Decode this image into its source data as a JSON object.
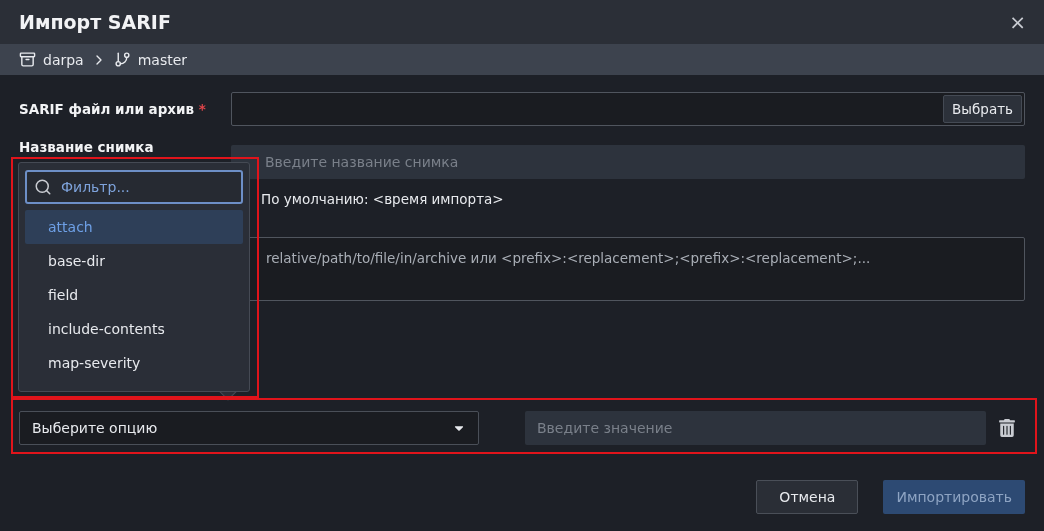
{
  "window": {
    "title": "Импорт SARIF",
    "close": "×"
  },
  "breadcrumb": [
    {
      "kind": "repo",
      "label": "darpa"
    },
    {
      "kind": "branch",
      "label": "master"
    }
  ],
  "form": {
    "file": {
      "label": "SARIF файл или архив",
      "required": "*",
      "button": "Выбрать"
    },
    "snapshot": {
      "label": "Название снимка",
      "placeholder": "Введите название снимка",
      "hint": "По умолчанию: <время импорта>"
    },
    "paths": {
      "placeholder": "relative/path/to/file/in/archive или <prefix>:<replacement>;<prefix>:<replacement>;..."
    }
  },
  "popover": {
    "filter_placeholder": "Фильтр...",
    "options": [
      {
        "label": "attach",
        "selected": true
      },
      {
        "label": "base-dir",
        "selected": false
      },
      {
        "label": "field",
        "selected": false
      },
      {
        "label": "include-contents",
        "selected": false
      },
      {
        "label": "map-severity",
        "selected": false
      }
    ]
  },
  "option_row": {
    "select": "Выберите опцию",
    "value_placeholder": "Введите значение"
  },
  "buttons": {
    "cancel": "Отмена",
    "submit": {
      "label": "Импортировать",
      "disabled": true
    }
  }
}
